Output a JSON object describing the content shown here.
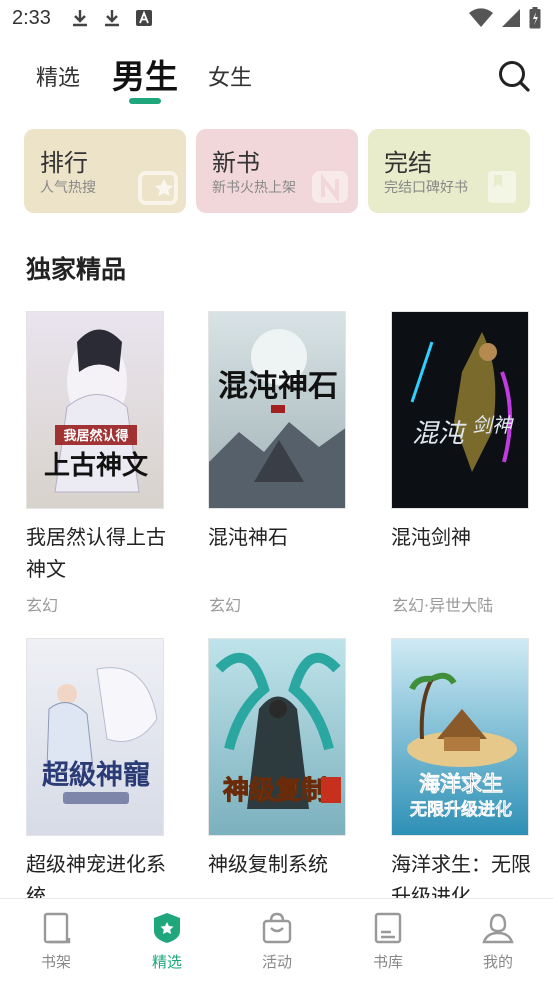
{
  "status_bar": {
    "time": "2:33"
  },
  "top_nav": {
    "tabs": [
      {
        "label": "精选"
      },
      {
        "label": "男生"
      },
      {
        "label": "女生"
      }
    ]
  },
  "quick_cards": [
    {
      "title": "排行",
      "subtitle": "人气热搜"
    },
    {
      "title": "新书",
      "subtitle": "新书火热上架"
    },
    {
      "title": "完结",
      "subtitle": "完结口碑好书"
    }
  ],
  "section": {
    "title": "独家精品"
  },
  "books": [
    {
      "title": "我居然认得上古神文",
      "tag": "玄幻",
      "cover_text": "我居然认得上古神文"
    },
    {
      "title": "混沌神石",
      "tag": "玄幻",
      "cover_text": "混沌神石"
    },
    {
      "title": "混沌剑神",
      "tag": "玄幻·异世大陆",
      "cover_text": "混沌剑神"
    },
    {
      "title": "超级神宠进化系统",
      "tag": "",
      "cover_text": "超級神寵"
    },
    {
      "title": "神级复制系统",
      "tag": "",
      "cover_text": "神级复制"
    },
    {
      "title": "海洋求生：无限升级进化",
      "tag": "",
      "cover_text": "海洋求生 无限升级进化"
    }
  ],
  "bottom_nav": [
    {
      "label": "书架"
    },
    {
      "label": "精选"
    },
    {
      "label": "活动"
    },
    {
      "label": "书库"
    },
    {
      "label": "我的"
    }
  ],
  "colors": {
    "accent": "#1fa67a",
    "card_rank": "#ede3c9",
    "card_new": "#f2d7da",
    "card_done": "#e8ecca"
  }
}
